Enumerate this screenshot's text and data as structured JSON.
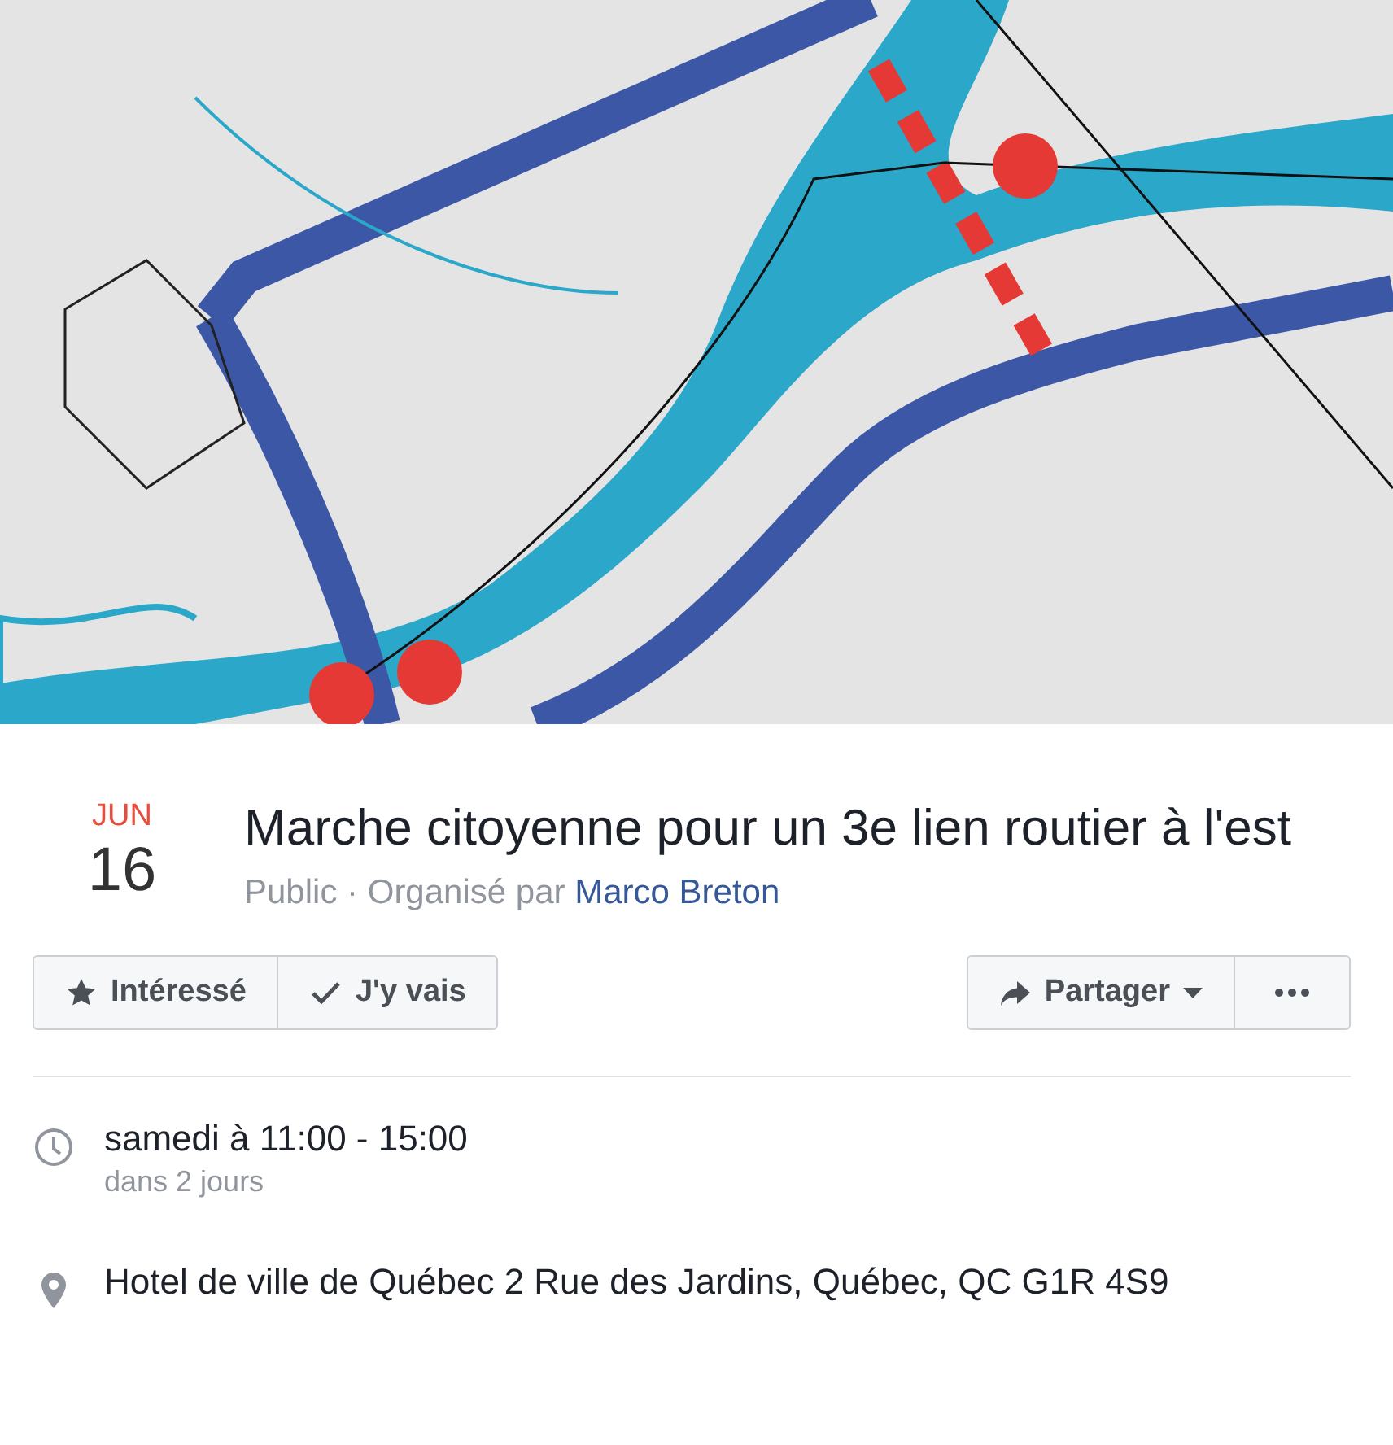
{
  "event": {
    "month": "JUN",
    "day": "16",
    "title": "Marche citoyenne pour un 3e lien routier à l'est",
    "meta": "Public · Organisé par",
    "organizer": "Marco Breton"
  },
  "actions": [
    {
      "label": "Intéressé",
      "kind": "interested"
    },
    {
      "label": "J'y vais",
      "kind": "going"
    }
  ],
  "share": {
    "label": "Partager"
  },
  "details": [
    {
      "kind": "time",
      "text": "samedi à 11:00 - 15:00",
      "subtext": "dans 2 jours"
    },
    {
      "kind": "place",
      "text": "Hotel de ville de Québec 2 Rue des Jardins, Québec, QC G1R 4S9"
    }
  ]
}
